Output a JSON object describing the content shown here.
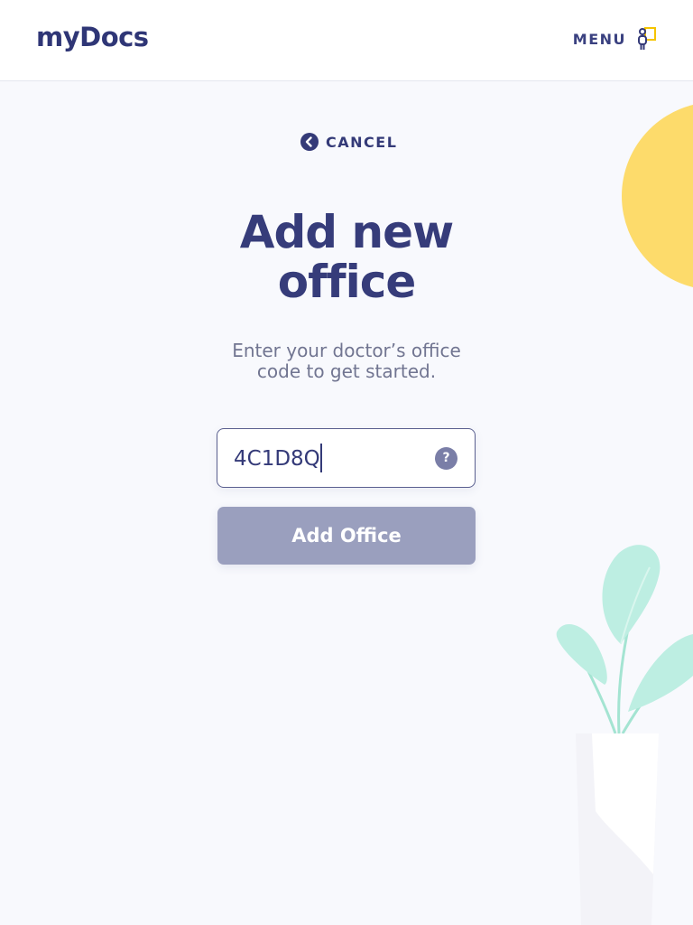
{
  "header": {
    "logo": "myDocs",
    "menu_label": "MENU",
    "menu_icon": "person-screen-icon"
  },
  "cancel": {
    "label": "CANCEL",
    "icon": "chevron-left-circle-icon"
  },
  "main": {
    "title_line1": "Add new",
    "title_line2": "office",
    "subtitle_line1": "Enter your doctor’s office",
    "subtitle_line2": "code to get started.",
    "code_value": "4C1D8Q",
    "help_glyph": "?",
    "button_label": "Add Office"
  },
  "colors": {
    "brand_navy": "#343a78",
    "background": "#f8f9fd",
    "button_disabled": "#9a9fbe",
    "sun_yellow": "#fddb6b",
    "leaf_mint": "#bdeee2",
    "menu_accent": "#f5c400"
  }
}
